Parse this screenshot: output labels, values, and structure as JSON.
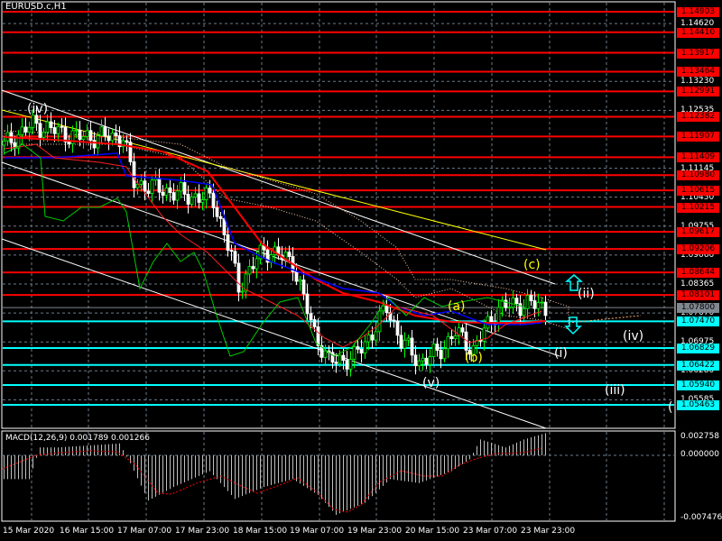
{
  "window": {
    "title": "EURUSD.c,H1"
  },
  "price_axis": {
    "ticks": [
      "1.14620",
      "1.13230",
      "1.12535",
      "1.11145",
      "1.10450",
      "1.09755",
      "1.09060",
      "1.08365",
      "1.07670",
      "1.06975",
      "1.06280",
      "1.05585"
    ],
    "red_levels": [
      "1.14903",
      "1.14410",
      "1.13917",
      "1.13464",
      "1.12991",
      "1.12382",
      "1.11907",
      "1.11409",
      "1.10980",
      "1.10615",
      "1.10215",
      "1.09617",
      "1.09206",
      "1.08644",
      "1.08101"
    ],
    "current_price": "1.07800",
    "cyan_levels": [
      "1.07470",
      "1.06829",
      "1.06422",
      "1.05940",
      "1.05463"
    ]
  },
  "colors": {
    "resistance": "#ff0000",
    "support": "#00ffff",
    "current": "#808890",
    "bull": "#00ff00",
    "bear": "#ffffff",
    "grid": "#6d7b8a",
    "wave_yellow": "#ffff00"
  },
  "wave_labels": [
    {
      "text": "(iv)",
      "color": "white"
    },
    {
      "text": "(c)",
      "color": "yellow"
    },
    {
      "text": "(ii)",
      "color": "white"
    },
    {
      "text": "(a)",
      "color": "yellow"
    },
    {
      "text": "(b)",
      "color": "yellow"
    },
    {
      "text": "(i)",
      "color": "white"
    },
    {
      "text": "(iv)",
      "color": "white"
    },
    {
      "text": "(v)",
      "color": "white"
    },
    {
      "text": "(iii)",
      "color": "white"
    },
    {
      "text": "(",
      "color": "white"
    }
  ],
  "macd": {
    "label": "MACD(12,26,9) 0.001789 0.001266",
    "axis_top": "0.002758",
    "axis_zero": "0.000000",
    "axis_bottom": "-0.007476"
  },
  "time_axis": [
    "15 Mar 2020",
    "16 Mar 15:00",
    "17 Mar 07:00",
    "17 Mar 23:00",
    "18 Mar 15:00",
    "19 Mar 07:00",
    "19 Mar 23:00",
    "20 Mar 15:00",
    "23 Mar 07:00",
    "23 Mar 23:00"
  ],
  "chart_data": {
    "symbol": "EURUSD.c",
    "timeframe": "H1",
    "price_waypoints": [
      [
        0,
        1.117
      ],
      [
        8,
        1.122
      ],
      [
        20,
        1.119
      ],
      [
        33,
        1.119
      ],
      [
        36,
        1.108
      ],
      [
        50,
        1.105
      ],
      [
        58,
        1.104
      ],
      [
        63,
        1.09
      ],
      [
        65,
        1.083
      ],
      [
        72,
        1.092
      ],
      [
        80,
        1.089
      ],
      [
        83,
        1.08
      ],
      [
        86,
        1.072
      ],
      [
        90,
        1.065
      ],
      [
        97,
        1.066
      ],
      [
        102,
        1.072
      ],
      [
        106,
        1.078
      ],
      [
        110,
        1.07
      ],
      [
        115,
        1.065
      ],
      [
        120,
        1.067
      ],
      [
        125,
        1.072
      ],
      [
        130,
        1.068
      ],
      [
        137,
        1.078
      ],
      [
        145,
        1.079
      ],
      [
        150,
        1.078
      ]
    ],
    "macd_hist_waypoints": [
      [
        0,
        -0.003
      ],
      [
        7,
        -0.003
      ],
      [
        10,
        0.001
      ],
      [
        15,
        0.001
      ],
      [
        32,
        0.0015
      ],
      [
        35,
        -0.001
      ],
      [
        40,
        -0.0057
      ],
      [
        47,
        -0.004
      ],
      [
        57,
        -0.002
      ],
      [
        64,
        -0.0055
      ],
      [
        72,
        -0.004
      ],
      [
        80,
        -0.003
      ],
      [
        87,
        -0.005
      ],
      [
        92,
        -0.0075
      ],
      [
        100,
        -0.006
      ],
      [
        107,
        -0.003
      ],
      [
        115,
        -0.0035
      ],
      [
        124,
        -0.002
      ],
      [
        129,
        -0.0005
      ],
      [
        132,
        0.002
      ],
      [
        139,
        0.001
      ],
      [
        144,
        0.002
      ],
      [
        150,
        0.0028
      ]
    ]
  }
}
